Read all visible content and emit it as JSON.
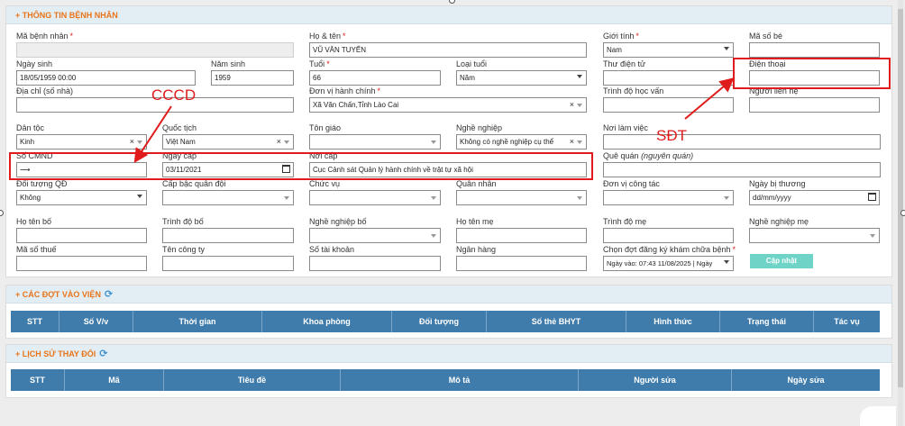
{
  "patient_section": {
    "title": "+ THÔNG TIN BỆNH NHÂN",
    "fields": {
      "ma_benh_nhan": {
        "label": "Mã bệnh nhân",
        "value": ""
      },
      "ho_ten": {
        "label": "Họ & tên",
        "value": "VŨ VĂN TUYỂN"
      },
      "gioi_tinh": {
        "label": "Giới tính",
        "value": "Nam"
      },
      "ma_so_be": {
        "label": "Mã số bé",
        "value": ""
      },
      "ngay_sinh": {
        "label": "Ngày sinh",
        "value": "18/05/1959 00:00"
      },
      "nam_sinh": {
        "label": "Năm sinh",
        "value": "1959"
      },
      "tuoi": {
        "label": "Tuổi",
        "value": "66"
      },
      "loai_tuoi": {
        "label": "Loại tuổi",
        "value": "Năm"
      },
      "thu_dien_tu": {
        "label": "Thư điện tử",
        "value": ""
      },
      "dien_thoai": {
        "label": "Điện thoại",
        "value": ""
      },
      "dia_chi": {
        "label": "Địa chỉ (số nhà)",
        "value": ""
      },
      "don_vi_hanh_chinh": {
        "label": "Đơn vị hành chính",
        "value": "Xã Văn Chấn,Tỉnh Lào Cai"
      },
      "trinh_do_hoc_van": {
        "label": "Trình độ học vấn",
        "value": ""
      },
      "nguoi_lien_he": {
        "label": "Người liên hệ",
        "value": ""
      },
      "dan_toc": {
        "label": "Dân tộc",
        "value": "Kinh"
      },
      "quoc_tich": {
        "label": "Quốc tịch",
        "value": "Việt Nam"
      },
      "ton_giao": {
        "label": "Tôn giáo",
        "value": ""
      },
      "nghe_nghiep": {
        "label": "Nghề nghiệp",
        "value": "Không có nghề nghiệp cụ thể"
      },
      "noi_lam_viec": {
        "label": "Nơi làm việc",
        "value": ""
      },
      "so_cmnd": {
        "label": "Số CMND",
        "value": "⟶"
      },
      "ngay_cap": {
        "label": "Ngày cấp",
        "value": "03/11/2021"
      },
      "noi_cap": {
        "label": "Nơi cấp",
        "value": "Cục Cảnh sát Quản lý hành chính về trật tự xã hội"
      },
      "que_quan": {
        "label": "Quê quán",
        "label_note": "(nguyên quán)",
        "value": ""
      },
      "doi_tuong_qd": {
        "label": "Đối tượng QĐ",
        "value": "Không"
      },
      "cap_bac": {
        "label": "Cấp bậc quân đội",
        "value": ""
      },
      "chuc_vu": {
        "label": "Chức vụ",
        "value": ""
      },
      "quan_nhan": {
        "label": "Quân nhân",
        "value": ""
      },
      "don_vi_cong_tac": {
        "label": "Đơn vị công tác",
        "value": ""
      },
      "ngay_bi_thuong": {
        "label": "Ngày bị thương",
        "value": "dd/mm/yyyy"
      },
      "ho_ten_bo": {
        "label": "Họ tên bố",
        "value": ""
      },
      "trinh_do_bo": {
        "label": "Trình độ bố",
        "value": ""
      },
      "nghe_nghiep_bo": {
        "label": "Nghề nghiệp bố",
        "value": ""
      },
      "ho_ten_me": {
        "label": "Họ tên mẹ",
        "value": ""
      },
      "trinh_do_me": {
        "label": "Trình độ mẹ",
        "value": ""
      },
      "nghe_nghiep_me": {
        "label": "Nghề nghiệp mẹ",
        "value": ""
      },
      "ma_so_thue": {
        "label": "Mã số thuế",
        "value": ""
      },
      "ten_cong_ty": {
        "label": "Tên công ty",
        "value": ""
      },
      "so_tai_khoan": {
        "label": "Số tài khoản",
        "value": ""
      },
      "ngan_hang": {
        "label": "Ngân hàng",
        "value": ""
      },
      "chon_dot": {
        "label": "Chọn đợt đăng ký khám chữa bệnh",
        "value": "Ngày vào: 07:43 11/08/2025 | Ngày"
      }
    },
    "required_mark": "*",
    "clear_mark": "×",
    "update_button": "Cập nhật"
  },
  "visits_section": {
    "title": "+ CÁC ĐỢT VÀO VIỆN",
    "refresh_icon": "⟳",
    "columns": [
      "STT",
      "Số V/v",
      "Thời gian",
      "Khoa phòng",
      "Đối tượng",
      "Số thẻ BHYT",
      "Hình thức",
      "Trạng thái",
      "Tác vụ"
    ]
  },
  "history_section": {
    "title": "+ LỊCH SỬ THAY ĐỔI",
    "refresh_icon": "⟳",
    "columns": [
      "STT",
      "Mã",
      "Tiêu đề",
      "Mô tả",
      "Người sửa",
      "Ngày sửa"
    ]
  },
  "annotations": {
    "cccd": "CCCD",
    "sdt": "SĐT",
    "color": "#e01b1b"
  },
  "colors": {
    "section_title": "#e8741a",
    "grid_header": "#3f7cab",
    "update_button": "#6fd3c7"
  }
}
